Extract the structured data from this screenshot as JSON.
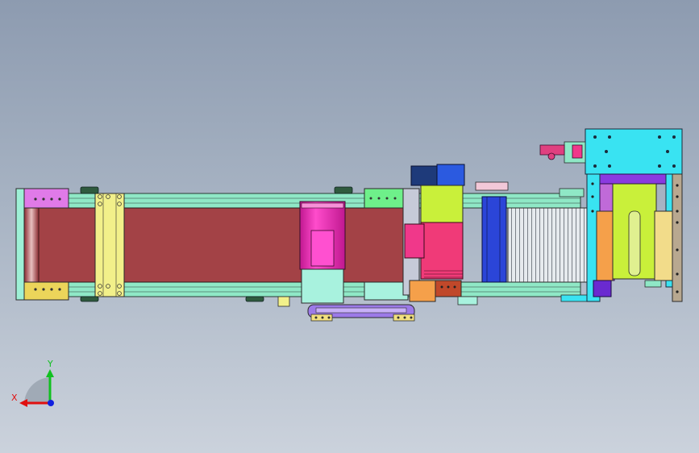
{
  "triad": {
    "x_label": "X",
    "y_label": "Y"
  },
  "colors": {
    "belt": "#a34246",
    "frame_rail": "#8fe8c6",
    "frame_rail_dark": "#5fb89a",
    "end_plate": "#e07ae8",
    "end_plate_yellow": "#ecd55a",
    "cross_bracket": "#f2f08a",
    "motor_body": "#ef2db6",
    "motor_cap": "#a8f2de",
    "gearbox": "#c9f03a",
    "motor2_body": "#f03a78",
    "blue_block": "#2b45d8",
    "navy_block": "#1e3a7a",
    "cyan_plate": "#39e3f2",
    "orange_block": "#f5a04a",
    "lime_block": "#c9f03a",
    "tan_block": "#f2dc8a",
    "purple_block": "#8a3ae0",
    "roller_gray": "#dde2e6",
    "axis_x": "#e01010",
    "axis_y": "#10c020",
    "axis_z": "#1020e0"
  }
}
